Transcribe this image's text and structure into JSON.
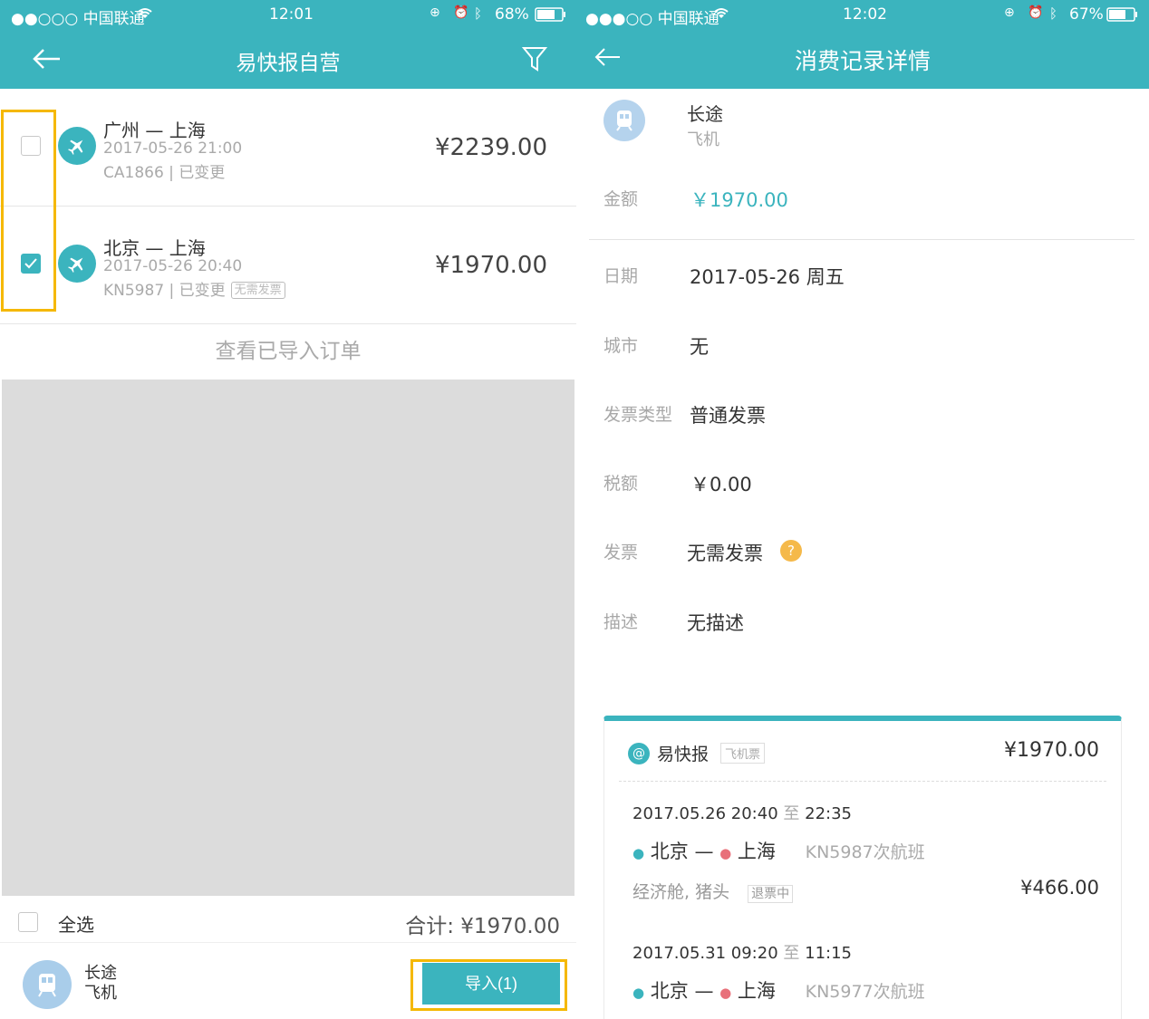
{
  "left": {
    "status": {
      "carrier": "●●○○○ 中国联通",
      "time": "12:01",
      "battery": "68%"
    },
    "nav": {
      "title": "易快报自营"
    },
    "orders": [
      {
        "route": "广州 — 上海",
        "datetime": "2017-05-26 21:00",
        "flight": "CA1866 | 已变更",
        "tag": "",
        "price": "¥2239.00",
        "checked": false
      },
      {
        "route": "北京 — 上海",
        "datetime": "2017-05-26 20:40",
        "flight": "KN5987 | 已变更",
        "tag": "无需发票",
        "price": "¥1970.00",
        "checked": true
      }
    ],
    "view_imported": "查看已导入订单",
    "select_all": "全选",
    "total": "合计: ¥1970.00",
    "category": {
      "title": "长途",
      "sub": "飞机"
    },
    "import_button": "导入(1)",
    "highlight_color": "#f5b800",
    "accent": "#3bb4be"
  },
  "right": {
    "status": {
      "carrier": "●●●○○ 中国联通",
      "time": "12:02",
      "battery": "67%"
    },
    "nav": {
      "title": "消费记录详情"
    },
    "category": {
      "title": "长途",
      "sub": "飞机"
    },
    "amount": {
      "label": "金额",
      "value": "￥1970.00"
    },
    "date": {
      "label": "日期",
      "value": "2017-05-26 周五"
    },
    "city": {
      "label": "城市",
      "value": "无"
    },
    "invoice_type": {
      "label": "发票类型",
      "value": "普通发票"
    },
    "tax": {
      "label": "税额",
      "value": "￥0.00"
    },
    "invoice": {
      "label": "发票",
      "value": "无需发票"
    },
    "desc": {
      "label": "描述",
      "value": "无描述"
    },
    "card": {
      "brand": "易快报",
      "tag": "飞机票",
      "total": "¥1970.00",
      "segments": [
        {
          "time": "2017.05.26 20:40",
          "to_word": "至",
          "end": "22:35",
          "from": "北京",
          "to": "上海",
          "flight": "KN5987次航班",
          "cabin": "经济舱, 猪头",
          "status": "退票中",
          "price": "¥466.00"
        },
        {
          "time": "2017.05.31 09:20",
          "to_word": "至",
          "end": "11:15",
          "from": "北京",
          "to": "上海",
          "flight": "KN5977次航班"
        }
      ]
    }
  }
}
